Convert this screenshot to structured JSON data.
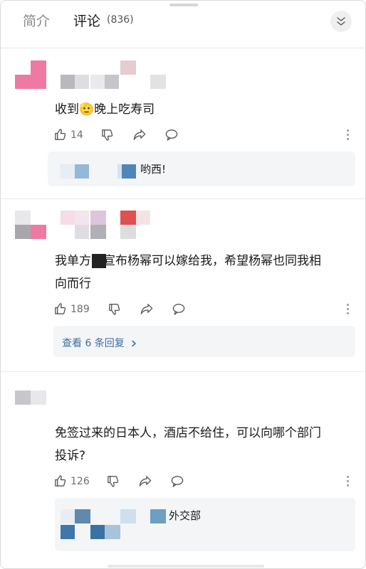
{
  "header": {
    "tab_intro": "简介",
    "tab_comments": "评论",
    "comment_count": "(836)",
    "close_icon": "chevron-down-icon"
  },
  "comments": [
    {
      "text": "收到🫡晚上吃寿司",
      "likes": "14",
      "reply": {
        "text": "哟西!"
      }
    },
    {
      "text_line1": "我单方面宣布杨幂可以嫁给我，希望杨幂也同我相",
      "text_line2": "向而行",
      "likes": "189",
      "view_replies": "查看 6 条回复"
    },
    {
      "text_line1": "免签过来的日本人，酒店不给住，可以向哪个部门",
      "text_line2": "投诉?",
      "likes": "126",
      "reply": {
        "text": "外交部"
      }
    }
  ],
  "colors": {
    "link": "#3b6ea5",
    "muted": "#8a8a8a",
    "reply_bg": "#f4f5f7"
  }
}
